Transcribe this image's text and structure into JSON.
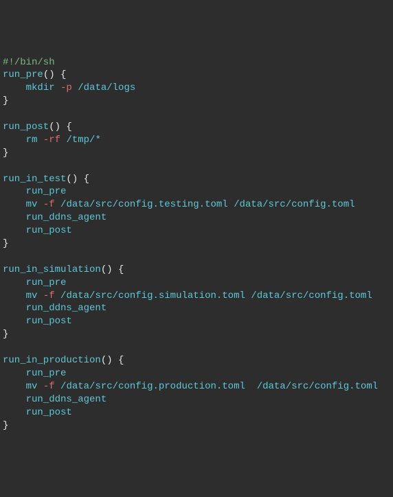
{
  "lines": [
    {
      "id": "l1",
      "segments": [
        {
          "cls": "c-comment",
          "text": "#!/bin/sh"
        }
      ]
    },
    {
      "id": "l2",
      "segments": [
        {
          "cls": "c-fn",
          "text": "run_pre"
        },
        {
          "cls": "c-punc",
          "text": "() {"
        }
      ]
    },
    {
      "id": "l3",
      "segments": [
        {
          "cls": "",
          "text": "    "
        },
        {
          "cls": "c-cmd",
          "text": "mkdir "
        },
        {
          "cls": "c-flag",
          "text": "-p"
        },
        {
          "cls": "c-path",
          "text": " /data/logs"
        }
      ]
    },
    {
      "id": "l4",
      "segments": [
        {
          "cls": "c-punc",
          "text": "}"
        }
      ]
    },
    {
      "id": "l5",
      "segments": [
        {
          "cls": "",
          "text": ""
        }
      ]
    },
    {
      "id": "l6",
      "segments": [
        {
          "cls": "c-fn",
          "text": "run_post"
        },
        {
          "cls": "c-punc",
          "text": "() {"
        }
      ]
    },
    {
      "id": "l7",
      "segments": [
        {
          "cls": "",
          "text": "    "
        },
        {
          "cls": "c-cmd",
          "text": "rm "
        },
        {
          "cls": "c-flag",
          "text": "-rf"
        },
        {
          "cls": "c-path",
          "text": " /tmp/*"
        }
      ]
    },
    {
      "id": "l8",
      "segments": [
        {
          "cls": "c-punc",
          "text": "}"
        }
      ]
    },
    {
      "id": "l9",
      "segments": [
        {
          "cls": "",
          "text": ""
        }
      ]
    },
    {
      "id": "l10",
      "segments": [
        {
          "cls": "c-fn",
          "text": "run_in_test"
        },
        {
          "cls": "c-punc",
          "text": "() {"
        }
      ]
    },
    {
      "id": "l11",
      "segments": [
        {
          "cls": "",
          "text": "    "
        },
        {
          "cls": "c-cmd",
          "text": "run_pre"
        }
      ]
    },
    {
      "id": "l12",
      "segments": [
        {
          "cls": "",
          "text": "    "
        },
        {
          "cls": "c-cmd",
          "text": "mv "
        },
        {
          "cls": "c-flag",
          "text": "-f"
        },
        {
          "cls": "c-path",
          "text": " /data/src/config.testing.toml /data/src/config.toml"
        }
      ]
    },
    {
      "id": "l13",
      "segments": [
        {
          "cls": "",
          "text": "    "
        },
        {
          "cls": "c-cmd",
          "text": "run_ddns_agent"
        }
      ]
    },
    {
      "id": "l14",
      "segments": [
        {
          "cls": "",
          "text": "    "
        },
        {
          "cls": "c-cmd",
          "text": "run_post"
        }
      ]
    },
    {
      "id": "l15",
      "segments": [
        {
          "cls": "c-punc",
          "text": "}"
        }
      ]
    },
    {
      "id": "l16",
      "segments": [
        {
          "cls": "",
          "text": ""
        }
      ]
    },
    {
      "id": "l17",
      "segments": [
        {
          "cls": "c-fn",
          "text": "run_in_simulation"
        },
        {
          "cls": "c-punc",
          "text": "() {"
        }
      ]
    },
    {
      "id": "l18",
      "segments": [
        {
          "cls": "",
          "text": "    "
        },
        {
          "cls": "c-cmd",
          "text": "run_pre"
        }
      ]
    },
    {
      "id": "l19",
      "segments": [
        {
          "cls": "",
          "text": "    "
        },
        {
          "cls": "c-cmd",
          "text": "mv "
        },
        {
          "cls": "c-flag",
          "text": "-f"
        },
        {
          "cls": "c-path",
          "text": " /data/src/config.simulation.toml /data/src/config.toml"
        }
      ]
    },
    {
      "id": "l20",
      "segments": [
        {
          "cls": "",
          "text": "    "
        },
        {
          "cls": "c-cmd",
          "text": "run_ddns_agent"
        }
      ]
    },
    {
      "id": "l21",
      "segments": [
        {
          "cls": "",
          "text": "    "
        },
        {
          "cls": "c-cmd",
          "text": "run_post"
        }
      ]
    },
    {
      "id": "l22",
      "segments": [
        {
          "cls": "c-punc",
          "text": "}"
        }
      ]
    },
    {
      "id": "l23",
      "segments": [
        {
          "cls": "",
          "text": ""
        }
      ]
    },
    {
      "id": "l24",
      "segments": [
        {
          "cls": "c-fn",
          "text": "run_in_production"
        },
        {
          "cls": "c-punc",
          "text": "() {"
        }
      ]
    },
    {
      "id": "l25",
      "segments": [
        {
          "cls": "",
          "text": "    "
        },
        {
          "cls": "c-cmd",
          "text": "run_pre"
        }
      ]
    },
    {
      "id": "l26",
      "segments": [
        {
          "cls": "",
          "text": "    "
        },
        {
          "cls": "c-cmd",
          "text": "mv "
        },
        {
          "cls": "c-flag",
          "text": "-f"
        },
        {
          "cls": "c-path",
          "text": " /data/src/config.production.toml  /data/src/config.toml"
        }
      ]
    },
    {
      "id": "l27",
      "segments": [
        {
          "cls": "",
          "text": "    "
        },
        {
          "cls": "c-cmd",
          "text": "run_ddns_agent"
        }
      ]
    },
    {
      "id": "l28",
      "segments": [
        {
          "cls": "",
          "text": "    "
        },
        {
          "cls": "c-cmd",
          "text": "run_post"
        }
      ]
    },
    {
      "id": "l29",
      "segments": [
        {
          "cls": "c-punc",
          "text": "}"
        }
      ]
    }
  ]
}
